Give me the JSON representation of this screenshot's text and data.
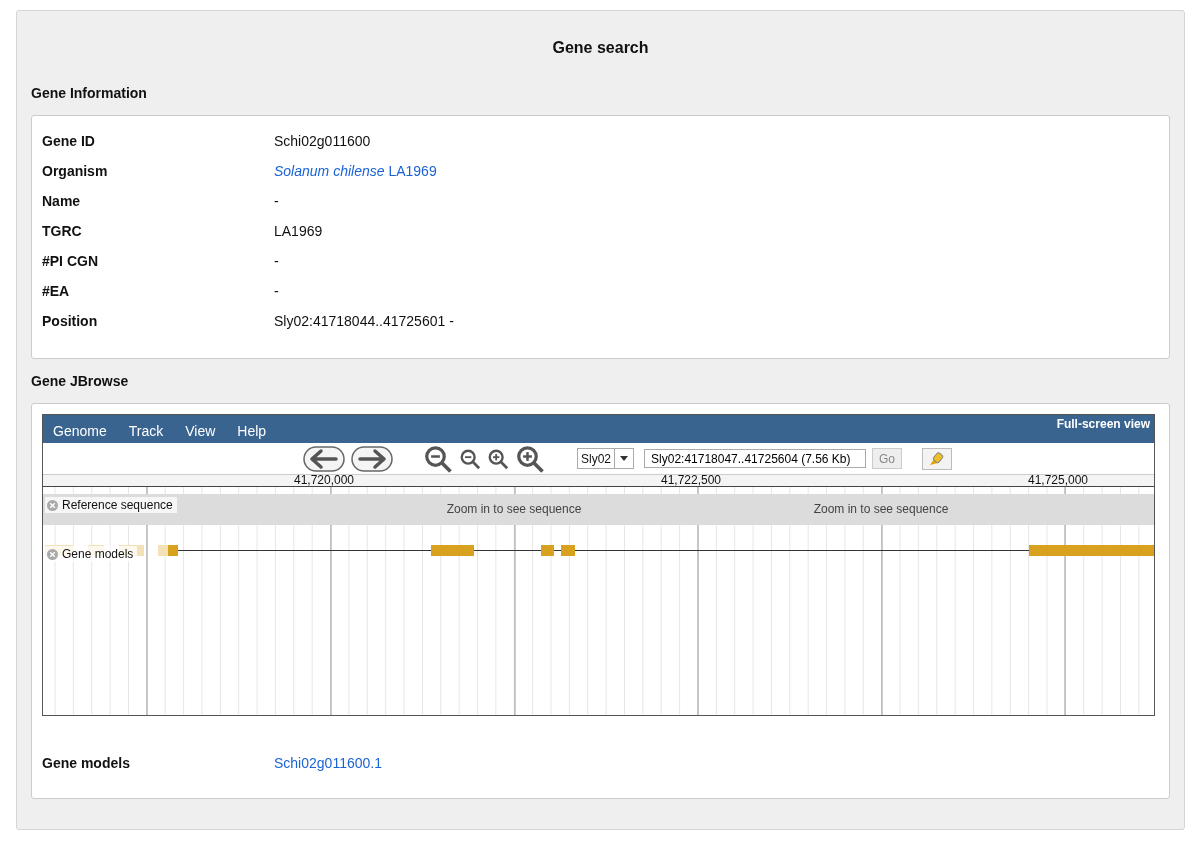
{
  "title": "Gene search",
  "info_section": {
    "heading": "Gene Information",
    "rows": [
      {
        "label": "Gene ID",
        "value": "Schi02g011600",
        "kind": "text"
      },
      {
        "label": "Organism",
        "value": "*Solanum chilense* LA1969",
        "kind": "link"
      },
      {
        "label": "Name",
        "value": "-",
        "kind": "text"
      },
      {
        "label": "TGRC",
        "value": "LA1969",
        "kind": "text"
      },
      {
        "label": "#PI CGN",
        "value": "-",
        "kind": "text"
      },
      {
        "label": "#EA",
        "value": "-",
        "kind": "text"
      },
      {
        "label": "Position",
        "value": "Sly02:41718044..41725601 -",
        "kind": "text"
      }
    ]
  },
  "jbrowse_section": {
    "heading": "Gene JBrowse",
    "menu": [
      "Genome",
      "Track",
      "View",
      "Help"
    ],
    "fullscreen": "Full-screen view",
    "chromosome": "Sly02",
    "location": "Sly02:41718047..41725604 (7.56 Kb)",
    "go_button": "Go",
    "ruler": [
      "41,720,000",
      "41,722,500",
      "41,725,000"
    ],
    "tracks": [
      {
        "label": "Reference sequence",
        "kind": "sequence",
        "notes": [
          "Zoom in to see sequence",
          "Zoom in to see sequence"
        ]
      },
      {
        "label": "Gene models",
        "kind": "genes"
      }
    ]
  },
  "gene_models": {
    "label": "Gene models",
    "value": "Schi02g011600.1"
  }
}
